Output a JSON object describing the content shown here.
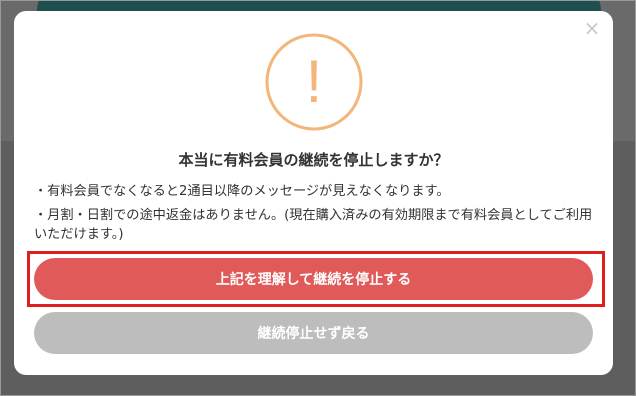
{
  "modal": {
    "close_glyph": "×",
    "alert_glyph": "!",
    "title": "本当に有料会員の継続を停止しますか？",
    "notes": [
      "・有料会員でなくなると2通目以降のメッセージが見えなくなります。",
      "・月割・日割での途中返金はありません。(現在購入済みの有効期限まで有料会員としてご利用いただけます。)"
    ],
    "confirm_label": "上記を理解して継続を停止する",
    "cancel_label": "継続停止せず戻る"
  },
  "colors": {
    "alert_ring": "#f3b57a",
    "confirm_button": "#e05a5a",
    "cancel_button": "#bdbdbd",
    "highlight_box": "#e01e1e",
    "overlay": "#6a6a6a"
  },
  "icons": {
    "close": "close-icon",
    "alert": "exclamation-circle-icon"
  }
}
